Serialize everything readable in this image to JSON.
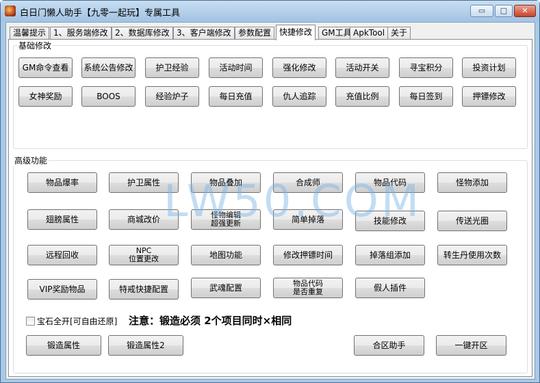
{
  "window": {
    "title": "白日门懒人助手【九零一起玩】专属工具",
    "controls": {
      "minimize": "▭",
      "maximize": "□",
      "close": "✕"
    }
  },
  "tabs": [
    {
      "label": "温馨提示"
    },
    {
      "label": "1、服务端修改"
    },
    {
      "label": "2、数据库修改"
    },
    {
      "label": "3、客户端修改"
    },
    {
      "label": "参数配置"
    },
    {
      "label": "快捷修改"
    },
    {
      "label": "GM工具"
    },
    {
      "label": "ApkTool"
    },
    {
      "label": "关于"
    }
  ],
  "active_tab": "快捷修改",
  "basic": {
    "label": "基础修改",
    "row1": [
      "GM命令查看",
      "系统公告修改",
      "护卫经验",
      "活动时间",
      "强化修改",
      "活动开关",
      "寻宝积分",
      "投资计划"
    ],
    "row2": [
      "女神奖励",
      "BOOS",
      "经验炉子",
      "每日充值",
      "仇人追踪",
      "充值比例",
      "每日签到",
      "押镖修改"
    ]
  },
  "advanced": {
    "label": "高级功能",
    "row1": [
      "物品爆率",
      "护卫属性",
      "物品叠加",
      "合成师",
      "物品代码",
      "怪物添加"
    ],
    "row2": [
      "翅膀属性",
      "商城改价",
      [
        "怪物编辑",
        "超强更新"
      ],
      "简单掉落",
      "技能修改",
      "传送光圈"
    ],
    "row3": [
      "远程回收",
      [
        "NPC",
        "位置更改"
      ],
      "地图功能",
      "修改押镖时间",
      "掉落组添加",
      "转生丹使用次数"
    ],
    "row4": [
      "VIP奖励物品",
      "特戒快捷配置",
      "武魂配置",
      [
        "物品代码",
        "是否重复"
      ],
      "假人插件"
    ],
    "gem_checkbox": "宝石全开[可自由还原]",
    "notice": "注意：锻造必须 2个项目同时×相同",
    "forge1": "锻造属性",
    "forge2": "锻造属性2",
    "merge": "合区助手",
    "one_click": "一键开区"
  },
  "watermark": "LW50.COM"
}
